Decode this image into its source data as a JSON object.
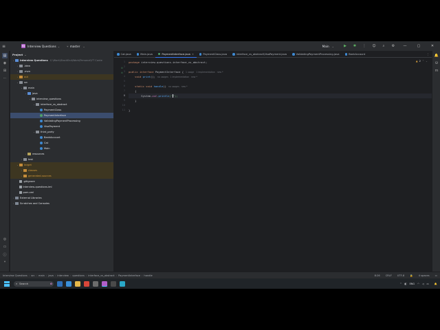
{
  "titlebar": {
    "project_initials": "IQ",
    "project_name": "Interview Questions",
    "branch": "master",
    "run_config": "Main"
  },
  "project_panel": {
    "title": "Project",
    "root_path_hint": "C:\\Work\\StackEnd\\Work\\Personal\\YT Conte",
    "items": [
      {
        "label": "Interview Questions",
        "icon": "folder-module-icon",
        "indent": 0,
        "open": true,
        "bold": true
      },
      {
        "label": ".idea",
        "icon": "folder-icon",
        "indent": 1,
        "open": false
      },
      {
        "label": ".mvn",
        "icon": "folder-icon",
        "indent": 1,
        "open": false
      },
      {
        "label": "out",
        "icon": "folder-excluded-icon",
        "indent": 1,
        "open": false,
        "excluded": true
      },
      {
        "label": "src",
        "icon": "folder-icon",
        "indent": 1,
        "open": true
      },
      {
        "label": "main",
        "icon": "folder-icon",
        "indent": 2,
        "open": true
      },
      {
        "label": "java",
        "icon": "folder-source-icon",
        "indent": 3,
        "open": true
      },
      {
        "label": "interview_questions",
        "icon": "package-icon",
        "indent": 4,
        "open": true
      },
      {
        "label": "interface_vs_abstract",
        "icon": "package-icon",
        "indent": 5,
        "open": true
      },
      {
        "label": "PaymentClass",
        "icon": "java-class-icon",
        "indent": 6
      },
      {
        "label": "PaymentInterface",
        "icon": "java-interface-icon",
        "indent": 6,
        "selected": true
      },
      {
        "label": "ValidatingPaymentProcessing",
        "icon": "java-class-icon",
        "indent": 6
      },
      {
        "label": "VisaPayment",
        "icon": "java-class-icon",
        "indent": 6
      },
      {
        "label": "third_party",
        "icon": "package-icon",
        "indent": 5,
        "open": true
      },
      {
        "label": "BankAccount",
        "icon": "java-class-icon",
        "indent": 6
      },
      {
        "label": "Cat",
        "icon": "java-class-icon",
        "indent": 6
      },
      {
        "label": "Main",
        "icon": "java-class-icon",
        "indent": 6
      },
      {
        "label": "resources",
        "icon": "folder-resources-icon",
        "indent": 3,
        "open": false
      },
      {
        "label": "test",
        "icon": "folder-icon",
        "indent": 2,
        "open": false
      },
      {
        "label": "target",
        "icon": "folder-excluded-icon",
        "indent": 1,
        "open": true,
        "excluded": true
      },
      {
        "label": "classes",
        "icon": "folder-excluded-icon",
        "indent": 2,
        "open": false,
        "excluded": true
      },
      {
        "label": "generated-sources",
        "icon": "folder-excluded-icon",
        "indent": 2,
        "open": false,
        "excluded": true
      },
      {
        "label": ".gitignore",
        "icon": "file-icon",
        "indent": 1
      },
      {
        "label": "interview-questions.iml",
        "icon": "file-icon",
        "indent": 1
      },
      {
        "label": "pom.xml",
        "icon": "maven-file-icon",
        "indent": 1
      },
      {
        "label": "External Libraries",
        "icon": "library-icon",
        "indent": 0,
        "open": false
      },
      {
        "label": "Scratches and Consoles",
        "icon": "scratch-icon",
        "indent": 0,
        "open": false
      }
    ]
  },
  "tabs": [
    {
      "label": "Cat.java",
      "kind": "class"
    },
    {
      "label": "Main.java",
      "kind": "class"
    },
    {
      "label": "PaymentInterface.java",
      "kind": "interface",
      "active": true
    },
    {
      "label": "PaymentClass.java",
      "kind": "class"
    },
    {
      "label": "interface_vs_abstract\\VisaPayment.java",
      "kind": "class"
    },
    {
      "label": "ValidatingPaymentProcessing.java",
      "kind": "class"
    },
    {
      "label": "BankAccount",
      "kind": "class"
    }
  ],
  "editor": {
    "warnings": "2",
    "line_numbers": [
      "1",
      "2",
      "3",
      "4",
      "5",
      "6",
      "7",
      "8",
      "9",
      "10",
      "11"
    ],
    "code": {
      "l1_kw": "package",
      "l1_rest": " interview.questions.interface_vs_abstract;",
      "l3_kw": "public interface",
      "l3_name": " PaymentInterface {",
      "l3_hint": "1 usage   1 implementation   new *",
      "l4_kw": "void",
      "l4_fn": " print",
      "l4_rest": "();",
      "l4_hint": "no usages   1 implementation   new *",
      "l6_kw": "static void",
      "l6_fn": " handle",
      "l6_rest": "()",
      "l6_hint": "no usages   new *",
      "l7": "{",
      "l8_a": "System.",
      "l8_b": "out",
      "l8_c": ".",
      "l8_fn": "println",
      "l8_d": "(\"",
      "l8_e": "\");",
      "l9": "}",
      "l11": "}"
    }
  },
  "statusbar": {
    "crumbs": [
      "Interview Questions",
      "src",
      "main",
      "java",
      "interview",
      "questions",
      "interface_vs_abstract",
      "PaymentInterface",
      "handle"
    ],
    "position": "8:26",
    "line_sep": "CRLF",
    "encoding": "UTF-8",
    "indent": "4 spaces"
  },
  "taskbar": {
    "search_placeholder": "Search",
    "lang": "ENG",
    "time": "",
    "date": ""
  }
}
